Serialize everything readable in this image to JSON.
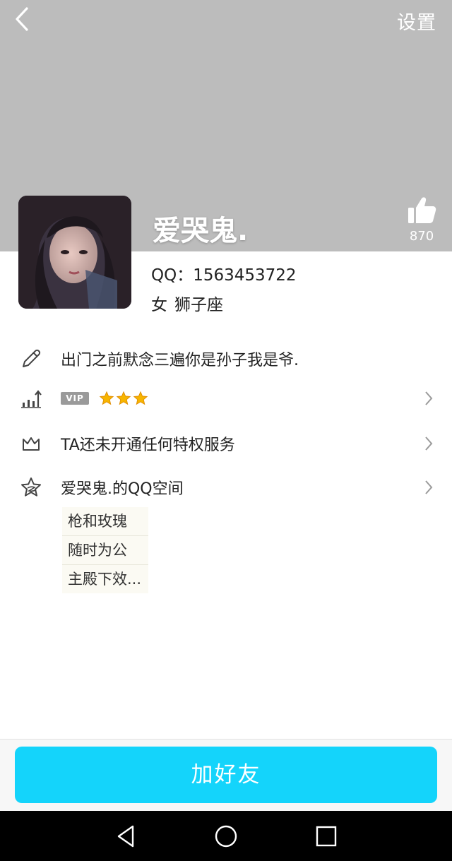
{
  "header": {
    "settings_label": "设置",
    "background_color": "#bcbcbc"
  },
  "profile": {
    "nickname": "爱哭鬼.",
    "likes": "870",
    "qq_label": "QQ：",
    "qq_number": "1563453722",
    "gender": "女",
    "zodiac": "狮子座"
  },
  "details": {
    "signature": "出门之前默念三遍你是孙子我是爷.",
    "vip_badge": "VIP",
    "vip_stars": 3,
    "privilege": "TA还未开通任何特权服务",
    "qzone": "爱哭鬼.的QQ空间"
  },
  "qzone_preview": {
    "lines": [
      "枪和玫瑰",
      "随时为公",
      "主殿下效..."
    ]
  },
  "actions": {
    "add_friend_label": "加好友",
    "accent_color": "#14d4fb"
  },
  "icons": {
    "back": "chevron-left-icon",
    "like": "thumbs-up-icon",
    "signature": "pencil-icon",
    "vip": "level-chart-icon",
    "privilege": "crown-icon",
    "qzone": "star-outline-icon"
  }
}
